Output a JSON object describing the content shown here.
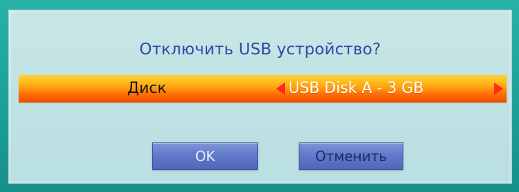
{
  "dialog": {
    "title": "Отключить USB устройство?",
    "row": {
      "label": "Диск",
      "value": "USB Disk A - 3 GB"
    },
    "buttons": {
      "ok_label": "OK",
      "cancel_label": "Отменить"
    }
  },
  "colors": {
    "frame": "#1e9f95",
    "dialog_bg": "#c4e4e5",
    "title_text": "#2f48a8",
    "highlight_row": "#ff9b10",
    "arrow": "#ff2a1a",
    "button": "#6179c9"
  },
  "icons": {
    "left_arrow": "chevron-left-icon",
    "right_arrow": "chevron-right-icon"
  }
}
